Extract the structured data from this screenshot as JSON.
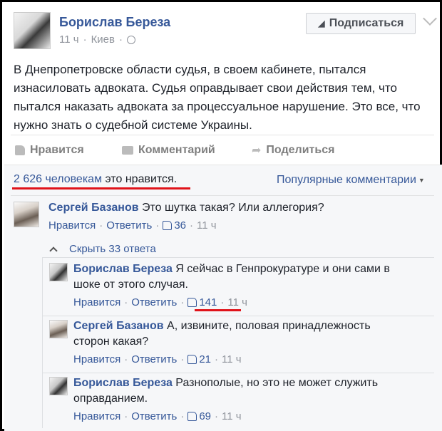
{
  "post": {
    "author": "Борислав Береза",
    "time": "11 ч",
    "location": "Киев",
    "subscribe_label": "Подписаться",
    "text": "В Днепропетровске области судья, в своем кабинете, пытался изнасиловать адвоката. Судья оправдывает свои действия тем, что пытался наказать адвоката за процессуальное нарушение. Это все, что нужно знать о судебной системе Украины."
  },
  "actions": {
    "like": "Нравится",
    "comment": "Комментарий",
    "share": "Поделиться"
  },
  "summary": {
    "likes_count": "2 626 человекам",
    "likes_suffix": "это нравится.",
    "popular": "Популярные комментарии"
  },
  "comments": [
    {
      "author": "Сергей Базанов",
      "text": "Это шутка такая? Или аллегория?",
      "like": "Нравится",
      "reply": "Ответить",
      "likes": "36",
      "time": "11 ч"
    }
  ],
  "hide_replies": "Скрыть 33 ответа",
  "replies": [
    {
      "author": "Борислав Береза",
      "text": "Я сейчас в Генпрокуратуре и они сами в шоке от этого случая.",
      "like": "Нравится",
      "reply": "Ответить",
      "likes": "141",
      "time": "11 ч"
    },
    {
      "author": "Сергей Базанов",
      "text": "А, извините, половая принадлежность сторон какая?",
      "like": "Нравится",
      "reply": "Ответить",
      "likes": "21",
      "time": "11 ч"
    },
    {
      "author": "Борислав Береза",
      "text": "Разнополые, но это не может служить оправданием.",
      "like": "Нравится",
      "reply": "Ответить",
      "likes": "69",
      "time": "11 ч"
    }
  ],
  "colors": {
    "link": "#365899",
    "muted": "#90949c",
    "highlight": "#e0131a"
  }
}
